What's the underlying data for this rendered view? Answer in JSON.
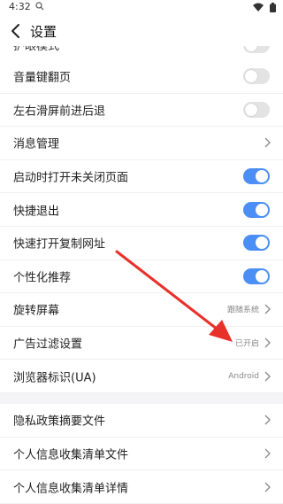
{
  "status_bar": {
    "time": "4:32"
  },
  "header": {
    "title": "设置"
  },
  "clipped_row": {
    "label": "护眼模式"
  },
  "list_a": [
    {
      "label": "音量键翻页",
      "type": "toggle",
      "on": false
    },
    {
      "label": "左右滑屏前进后退",
      "type": "toggle",
      "on": false
    },
    {
      "label": "消息管理",
      "type": "link",
      "value": ""
    },
    {
      "label": "启动时打开未关闭页面",
      "type": "toggle",
      "on": true
    },
    {
      "label": "快捷退出",
      "type": "toggle",
      "on": true
    },
    {
      "label": "快速打开复制网址",
      "type": "toggle",
      "on": true
    },
    {
      "label": "个性化推荐",
      "type": "toggle",
      "on": true
    },
    {
      "label": "旋转屏幕",
      "type": "link",
      "value": "跟随系统"
    },
    {
      "label": "广告过滤设置",
      "type": "link",
      "value": "已开启"
    },
    {
      "label": "浏览器标识(UA)",
      "type": "link",
      "value": "Android"
    }
  ],
  "list_b": [
    {
      "label": "隐私政策摘要文件",
      "type": "link",
      "value": ""
    },
    {
      "label": "个人信息收集清单文件",
      "type": "link",
      "value": ""
    },
    {
      "label": "个人信息收集清单详情",
      "type": "link",
      "value": ""
    }
  ],
  "colors": {
    "toggle_on": "#4a8ef6",
    "toggle_off": "#e3e3e3",
    "annotation_arrow": "#e8312a"
  }
}
